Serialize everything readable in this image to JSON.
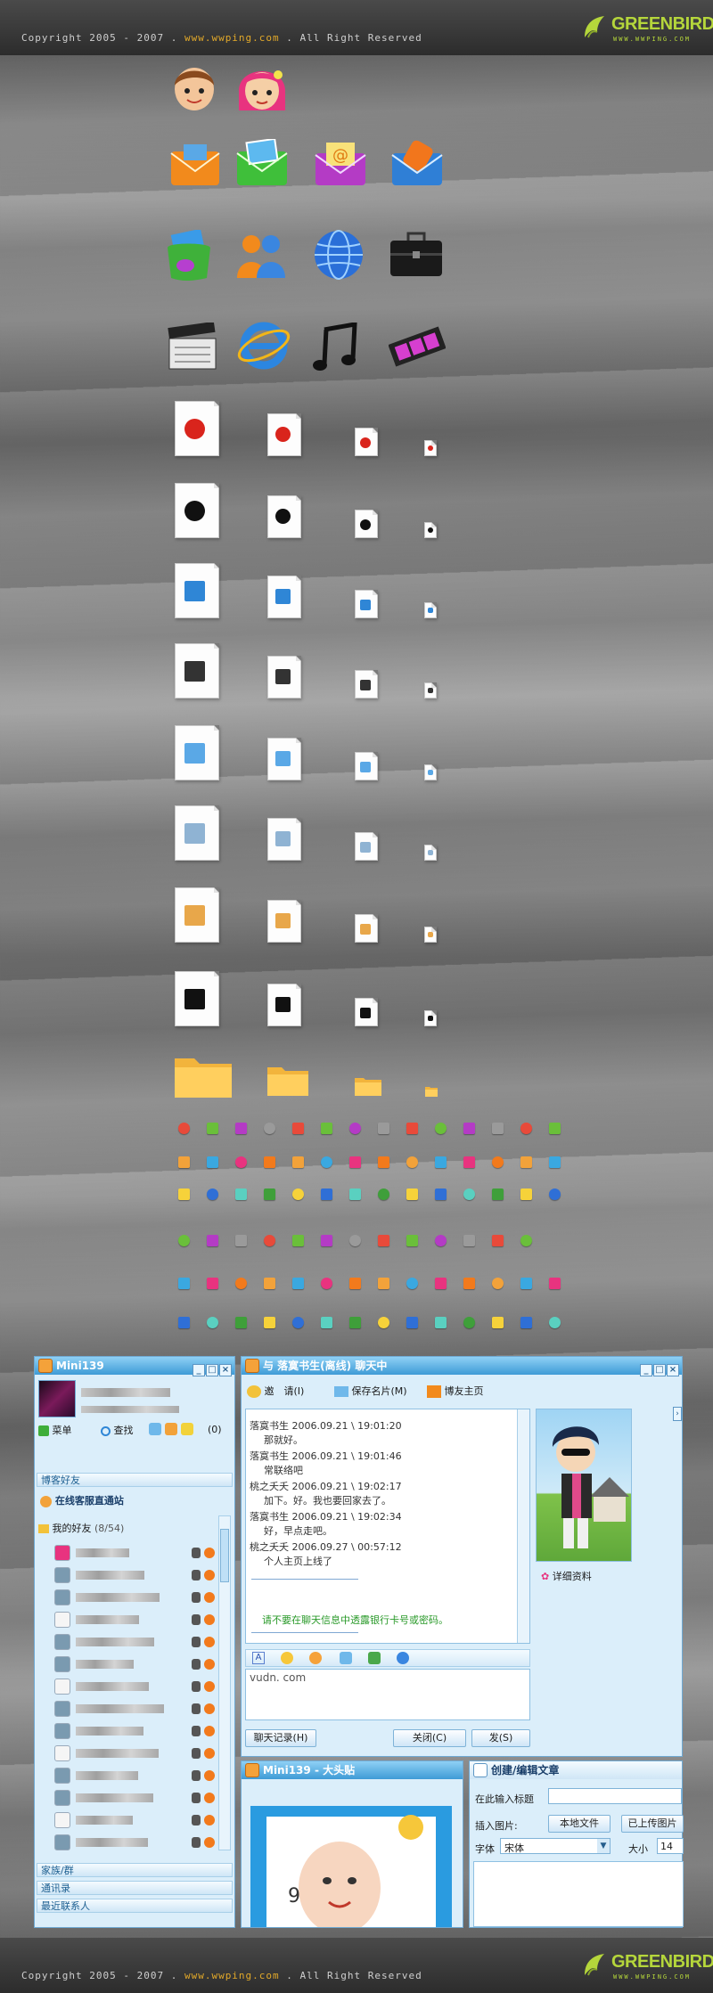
{
  "copyright": {
    "prefix": "Copyright 2005 - 2007 . ",
    "site": "www.wwping.com",
    "suffix": " . All Right Reserved"
  },
  "logo": {
    "name": "GREENBIRD",
    "sub": "WWW.WWPING.COM"
  },
  "mini_window": {
    "title": "Mini139",
    "menu_label": "菜单",
    "find_label": "查找",
    "count_badge": "(0)",
    "blog_friends": "博客好友",
    "online_service": "在线客服直通站",
    "my_friends": "我的好友",
    "my_friends_count": "(8/54)",
    "family_group": "家族/群",
    "contacts": "通讯录",
    "recent_contacts": "最近联系人"
  },
  "chat_window": {
    "title": "与 落寞书生(离线) 聊天中",
    "invite_label": "邀　请(I)",
    "save_card_label": "保存名片(M)",
    "blog_home_label": "博友主页",
    "messages": [
      {
        "header": "落寞书生 2006.09.21 \\ 19:01:20",
        "body": "那就好。"
      },
      {
        "header": "落寞书生 2006.09.21 \\ 19:01:46",
        "body": "常联络吧"
      },
      {
        "header": "桃之夭夭 2006.09.21 \\ 19:02:17",
        "body": "加下。好。我也要回家去了。"
      },
      {
        "header": "落寞书生 2006.09.21 \\ 19:02:34",
        "body": "好，早点走吧。"
      },
      {
        "header": "桃之夭夭 2006.09.27 \\ 00:57:12",
        "body": "个人主页上线了"
      }
    ],
    "warning": "请不要在聊天信息中透露银行卡号或密码。",
    "input_text": "vudn. com",
    "profile_link": "详细资料",
    "history_button": "聊天记录(H)",
    "close_button": "关闭(C)",
    "send_button": "发(S)"
  },
  "avatar_window": {
    "title": "Mini139 - 大头贴"
  },
  "edit_window": {
    "title": "创建/编辑文章",
    "title_placeholder": "在此输入标题",
    "insert_image_label": "插入图片:",
    "local_file_button": "本地文件",
    "uploaded_image_button": "已上传图片",
    "font_label": "字体",
    "font_value": "宋体",
    "size_label": "大小",
    "size_value": "14"
  },
  "colors": {
    "accent": "#3e9bd6",
    "logo": "#b5d63b",
    "warning": "#2a9a2a"
  }
}
